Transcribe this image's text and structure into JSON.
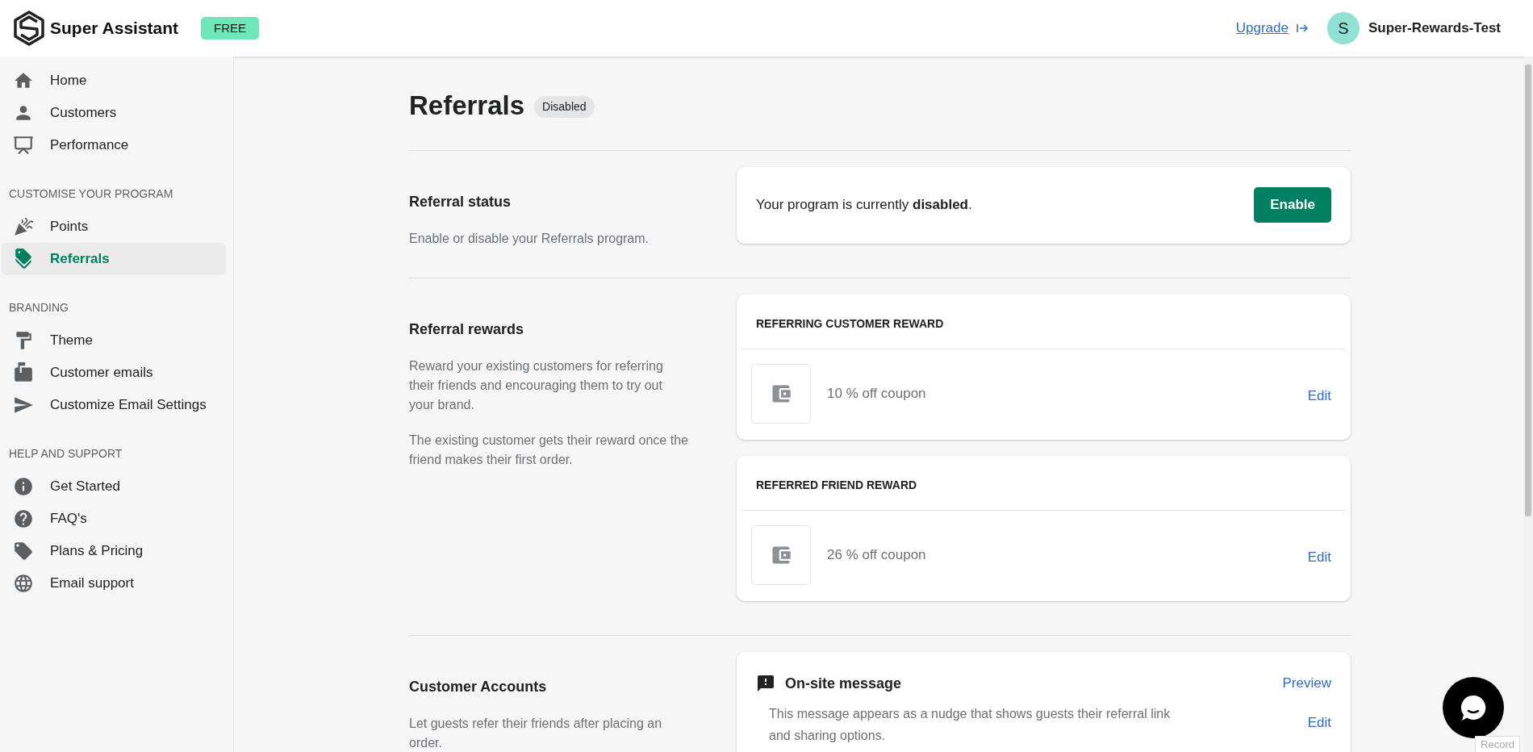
{
  "header": {
    "brand": "Super Assistant",
    "plan_badge": "FREE",
    "upgrade_link": "Upgrade",
    "avatar_initial": "S",
    "account_name": "Super-Rewards-Test"
  },
  "sidebar": {
    "groups": [
      {
        "items": [
          {
            "label": "Home",
            "selected": false
          },
          {
            "label": "Customers",
            "selected": false
          },
          {
            "label": "Performance",
            "selected": false
          }
        ]
      },
      {
        "heading": "CUSTOMISE YOUR PROGRAM",
        "items": [
          {
            "label": "Points",
            "selected": false
          },
          {
            "label": "Referrals",
            "selected": true
          }
        ]
      },
      {
        "heading": "BRANDING",
        "items": [
          {
            "label": "Theme",
            "selected": false
          },
          {
            "label": "Customer emails",
            "selected": false
          },
          {
            "label": "Customize Email Settings",
            "selected": false
          }
        ]
      },
      {
        "heading": "HELP AND SUPPORT",
        "items": [
          {
            "label": "Get Started",
            "selected": false
          },
          {
            "label": "FAQ's",
            "selected": false
          },
          {
            "label": "Plans & Pricing",
            "selected": false
          },
          {
            "label": "Email support",
            "selected": false
          }
        ]
      }
    ]
  },
  "page": {
    "title": "Referrals",
    "status_badge": "Disabled"
  },
  "sections": [
    {
      "title": "Referral status",
      "paragraphs": [
        "Enable or disable your Referrals program."
      ],
      "cards": [
        {
          "kind": "status",
          "message": "Your program is currently **disabled**.",
          "button": "Enable"
        }
      ]
    },
    {
      "title": "Referral rewards",
      "paragraphs": [
        "Reward your existing customers for referring their friends and encouraging them to try out your brand.",
        "The existing customer gets their reward once the friend makes their first order."
      ],
      "cards": [
        {
          "kind": "reward",
          "heading": "REFERRING CUSTOMER REWARD",
          "reward": "10 % off coupon",
          "action": "Edit"
        },
        {
          "kind": "reward",
          "heading": "REFERRED FRIEND REWARD",
          "reward": "26 % off coupon",
          "action": "Edit"
        }
      ]
    },
    {
      "title": "Customer Accounts",
      "paragraphs": [
        "Let guests refer their friends after placing an order."
      ],
      "cards": [
        {
          "kind": "message",
          "heading": "On-site message",
          "link": "Preview",
          "description": "This message appears as a nudge that shows guests their referral link and sharing options.",
          "action": "Edit"
        }
      ]
    }
  ],
  "record_label": "Record"
}
